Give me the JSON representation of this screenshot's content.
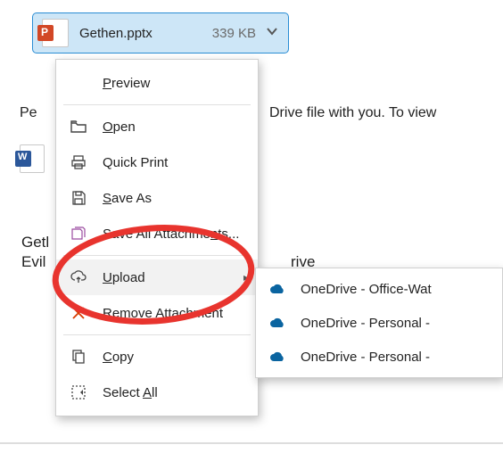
{
  "attachment": {
    "filename": "Gethen.pptx",
    "size": "339 KB"
  },
  "background": {
    "line1_left": "Pe",
    "line1_right": "Drive file with you. To view",
    "line2a": "Getl",
    "line2b": "Evil",
    "line2c": "rive"
  },
  "menu": {
    "preview": "Preview",
    "open": "Open",
    "quick_print": "Quick Print",
    "save_as": "Save As",
    "save_all": "Save All Attachments...",
    "upload": "Upload",
    "remove": "Remove Attachment",
    "copy": "Copy",
    "select_all": "Select All"
  },
  "submenu": {
    "items": [
      "OneDrive - Office-Wat",
      "OneDrive - Personal -",
      "OneDrive - Personal -"
    ]
  }
}
